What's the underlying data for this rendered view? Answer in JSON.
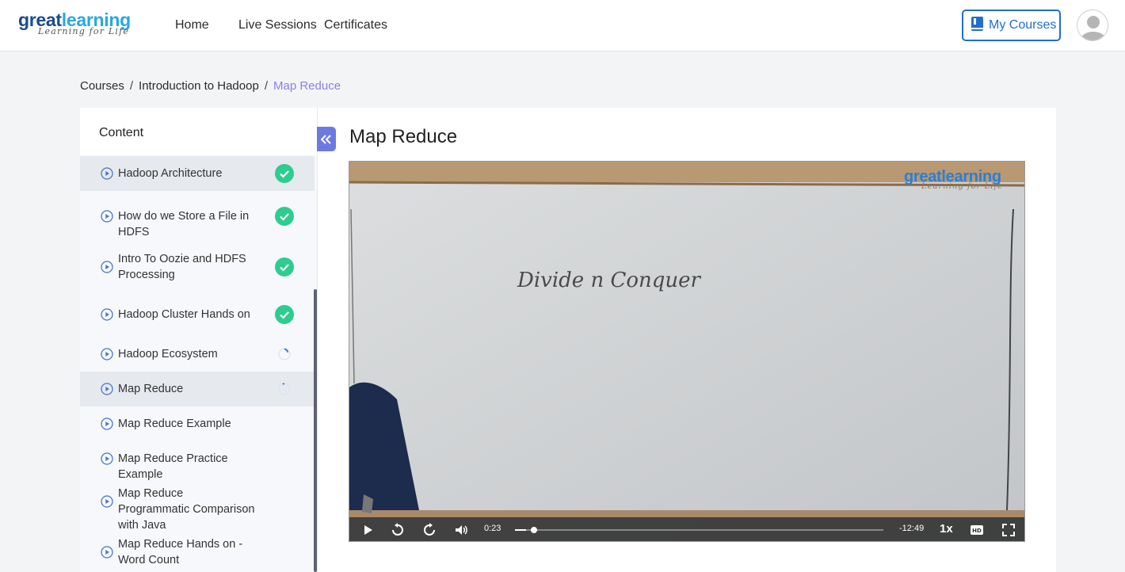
{
  "header": {
    "logo": {
      "word1": "great",
      "word2": "learning",
      "tagline": "Learning for Life"
    },
    "nav": [
      "Home",
      "Live Sessions",
      "Certificates"
    ],
    "my_courses": "My Courses",
    "avatar_icon": "user-avatar-icon"
  },
  "breadcrumb": {
    "items": [
      "Courses",
      "Introduction to Hadoop",
      "Map Reduce"
    ],
    "separator": "/"
  },
  "sidebar": {
    "title": "Content",
    "lessons": [
      {
        "label": "Hadoop Architecture",
        "status": "completed",
        "selected": true
      },
      {
        "label": "How do we Store a File in HDFS",
        "status": "completed",
        "selected": false
      },
      {
        "label": "Intro To Oozie and HDFS Processing",
        "status": "completed",
        "selected": false
      },
      {
        "label": "Hadoop Cluster Hands on",
        "status": "completed",
        "selected": false
      },
      {
        "label": "Hadoop Ecosystem",
        "status": "in-progress",
        "selected": false
      },
      {
        "label": "Map Reduce",
        "status": "in-progress",
        "selected": true
      },
      {
        "label": "Map Reduce Example",
        "status": "none",
        "selected": false
      },
      {
        "label": "Map Reduce Practice Example",
        "status": "none",
        "selected": false
      },
      {
        "label": "Map Reduce Programmatic Comparison with Java",
        "status": "none",
        "selected": false
      },
      {
        "label": "Map Reduce Hands on - Word Count",
        "status": "none",
        "selected": false
      }
    ]
  },
  "lesson_title": "Map Reduce",
  "video": {
    "watermark": {
      "word1": "great",
      "word2": "learning",
      "tagline": "Learning for Life"
    },
    "whiteboard_text": "Divide n Conquer",
    "current_time": "0:23",
    "remaining_time": "-12:49",
    "progress": 0.03,
    "speed": "1x",
    "controls": [
      "play-icon",
      "rewind-icon",
      "forward-icon",
      "volume-icon",
      "hd-icon",
      "fullscreen-icon"
    ]
  },
  "colors": {
    "accent": "#6c7ae0",
    "brand_blue": "#1f6fce",
    "completed": "#2ecc8f",
    "breadcrumb_active": "#8c7ee8"
  }
}
